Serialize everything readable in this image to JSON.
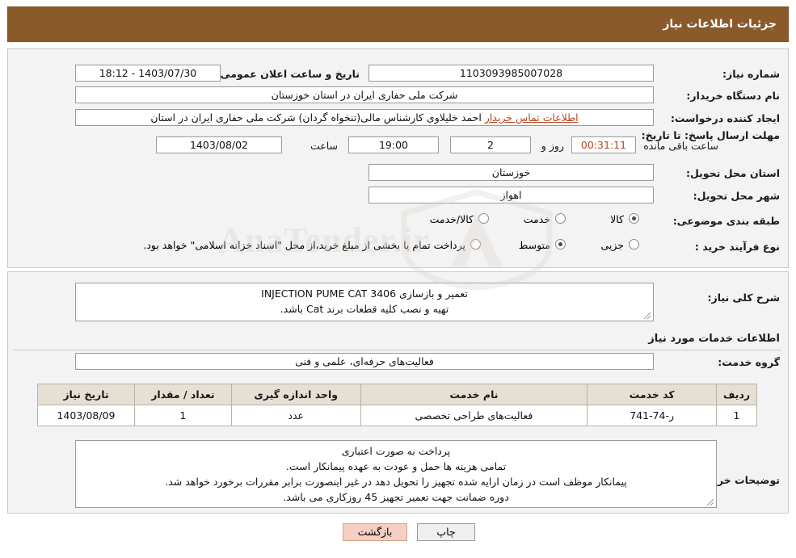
{
  "header": {
    "title": "جزئیات اطلاعات نیاز"
  },
  "details": {
    "need_number_label": "شماره نیاز:",
    "need_number_value": "1103093985007028",
    "announce_datetime_label": "تاریخ و ساعت اعلان عمومی:",
    "announce_datetime_value": "1403/07/30 - 18:12",
    "buyer_org_label": "نام دستگاه خریدار:",
    "buyer_org_value": "شرکت ملی حفاری ایران در استان خوزستان",
    "requester_label": "ایجاد کننده درخواست:",
    "requester_value": "احمد خلیلاوی کارشناس مالی(تنخواه گردان) شرکت ملی حفاری ایران در استان",
    "requester_link": "اطلاعات تماس خریدار",
    "deadline_label": "مهلت ارسال پاسخ: تا تاریخ:",
    "deadline_date": "1403/08/02",
    "deadline_hour_label": "ساعت",
    "deadline_hour": "19:00",
    "days_value": "2",
    "days_label": "روز و",
    "countdown": "00:31:11",
    "countdown_suffix": "ساعت باقی مانده",
    "delivery_province_label": "استان محل تحویل:",
    "delivery_province_value": "خوزستان",
    "delivery_city_label": "شهر محل تحویل:",
    "delivery_city_value": "اهواز",
    "category_label": "طبقه بندی موضوعی:",
    "category_options": [
      {
        "label": "کالا",
        "checked": false
      },
      {
        "label": "خدمت",
        "checked": true
      },
      {
        "label": "کالا/خدمت",
        "checked": false
      }
    ],
    "process_label": "نوع فرآیند خرید :",
    "process_options": [
      {
        "label": "جزیی",
        "checked": false
      },
      {
        "label": "متوسط",
        "checked": true
      }
    ],
    "process_note": "پرداخت تمام یا بخشی از مبلغ خرید،از محل \"اسناد خزانه اسلامی\" خواهد بود."
  },
  "description": {
    "general_label": "شرح کلی نیاز:",
    "general_text_line1": "تعمیر و بازسازی INJECTION PUME CAT 3406",
    "general_text_line2": "تهیه و نصب کلیه قطعات برند Cat باشد.",
    "services_heading": "اطلاعات خدمات مورد نیاز",
    "service_group_label": "گروه خدمت:",
    "service_group_value": "فعالیت‌های حرفه‌ای، علمی و فنی"
  },
  "table": {
    "columns": [
      "ردیف",
      "کد خدمت",
      "نام خدمت",
      "واحد اندازه گیری",
      "تعداد / مقدار",
      "تاریخ نیاز"
    ],
    "rows": [
      {
        "row": "1",
        "code": "ر-74-741",
        "name": "فعالیت‌های طراحی تخصصی",
        "unit": "عدد",
        "qty": "1",
        "date": "1403/08/09"
      }
    ]
  },
  "buyer_notes": {
    "label": "توضیحات خریدار:",
    "lines": [
      "پرداخت به صورت اعتباری",
      "تمامی هزینه ها حمل و عودت به عهده پیمانکار است.",
      "پیمانکار موظف است در زمان ارایه شده تجهیز را تحویل دهد در غیر اینصورت برابر مقررات برخورد خواهد شد.",
      "دوره ضمانت جهت تعمیر تجهیز 45 روزکاری می باشد."
    ]
  },
  "footer": {
    "print_label": "چاپ",
    "back_label": "بازگشت"
  },
  "watermark": {
    "text": "AnaTender.ir"
  }
}
